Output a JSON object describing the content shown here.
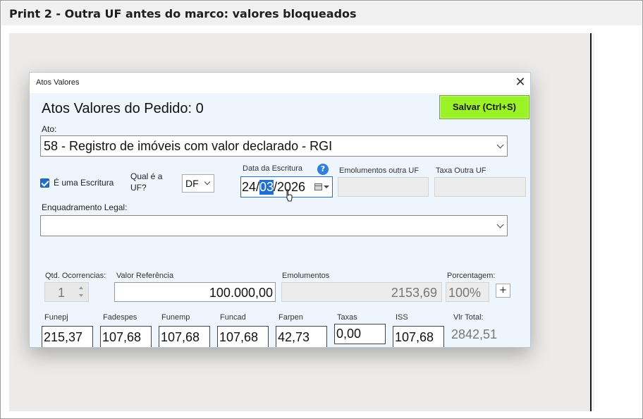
{
  "page": {
    "title": "Print 2 - Outra UF antes do marco: valores bloqueados"
  },
  "dialog": {
    "title": "Atos Valores",
    "close_glyph": "✕",
    "heading": "Atos Valores do Pedido: 0",
    "save_label": "Salvar (Ctrl+S)",
    "ato_label": "Ato:",
    "ato_value": "58 - Registro de imóveis com valor declarado - RGI",
    "escritura_label": "É uma Escritura",
    "escritura_checked": true,
    "qual_uf_label_1": "Qual é a",
    "qual_uf_label_2": "UF?",
    "uf_value": "DF",
    "data_escritura_label": "Data da Escritura",
    "data_escritura": {
      "day": "24",
      "sep1": "/",
      "month": "03",
      "sep2": "/",
      "year": "2026"
    },
    "help_glyph": "?",
    "emolumentos_outra_uf_label": "Emolumentos outra UF",
    "emolumentos_outra_uf_value": "",
    "taxa_outra_uf_label": "Taxa Outra UF",
    "taxa_outra_uf_value": "",
    "enquadramento_label": "Enquadramento Legal:",
    "enquadramento_value": "",
    "qtd_label": "Qtd. Ocorrencias:",
    "qtd_value": "1",
    "valor_ref_label": "Valor Referência",
    "valor_ref_value": "100.000,00",
    "emolumentos_label": "Emolumentos",
    "emolumentos_value": "2153,69",
    "porcentagem_label": "Porcentagem:",
    "porcentagem_value": "100%",
    "plus_label": "+",
    "fees": [
      {
        "label": "Funepj",
        "value": "215,37"
      },
      {
        "label": "Fadespes",
        "value": "107,68"
      },
      {
        "label": "Funemp",
        "value": "107,68"
      },
      {
        "label": "Funcad",
        "value": "107,68"
      },
      {
        "label": "Farpen",
        "value": "42,73"
      },
      {
        "label": "Taxas",
        "value": "0,00"
      },
      {
        "label": "ISS",
        "value": "107,68"
      }
    ],
    "total_label": "Vlr Total:",
    "total_value": "2842,51"
  },
  "colors": {
    "save_button": "#9bf227",
    "selection": "#1e6fd0",
    "dialog_bg": "#eef5fd"
  }
}
